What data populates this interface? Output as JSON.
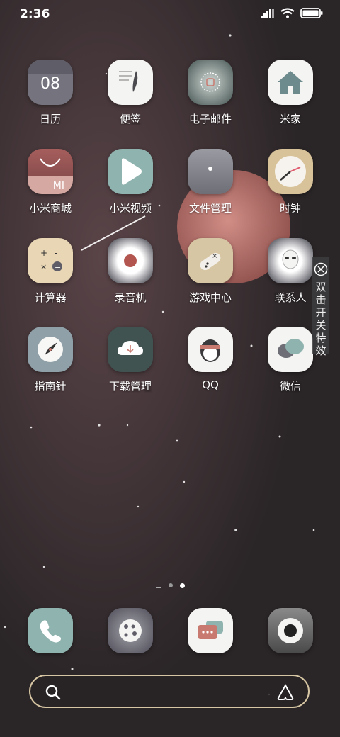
{
  "status_bar": {
    "time": "2:36",
    "icons": [
      "signal-icon",
      "wifi-icon",
      "battery-icon"
    ]
  },
  "apps": [
    {
      "label": "日历",
      "icon": "calendar-icon",
      "text": "08"
    },
    {
      "label": "便签",
      "icon": "notes-icon"
    },
    {
      "label": "电子邮件",
      "icon": "email-icon"
    },
    {
      "label": "米家",
      "icon": "home-icon"
    },
    {
      "label": "小米商城",
      "icon": "mall-icon",
      "text": "MI"
    },
    {
      "label": "小米视频",
      "icon": "video-icon"
    },
    {
      "label": "文件管理",
      "icon": "folder-icon"
    },
    {
      "label": "时钟",
      "icon": "clock-icon"
    },
    {
      "label": "计算器",
      "icon": "calculator-icon"
    },
    {
      "label": "录音机",
      "icon": "recorder-icon"
    },
    {
      "label": "游戏中心",
      "icon": "game-icon"
    },
    {
      "label": "联系人",
      "icon": "contacts-icon"
    },
    {
      "label": "指南针",
      "icon": "compass-icon"
    },
    {
      "label": "下载管理",
      "icon": "download-icon"
    },
    {
      "label": "QQ",
      "icon": "qq-icon"
    },
    {
      "label": "微信",
      "icon": "wechat-icon"
    }
  ],
  "side_panel": {
    "text": "双击开关特效"
  },
  "page_indicator": {
    "current": 3,
    "total": 3
  },
  "dock": [
    {
      "icon": "phone-icon"
    },
    {
      "icon": "gallery-icon"
    },
    {
      "icon": "messages-icon"
    },
    {
      "icon": "camera-icon"
    }
  ],
  "search_bar": {
    "left_icon": "search-icon",
    "right_icon": "assistant-icon"
  },
  "colors": {
    "background": "#2a2527",
    "planet": "#c97a70",
    "search_border": "#d7c6a3"
  }
}
